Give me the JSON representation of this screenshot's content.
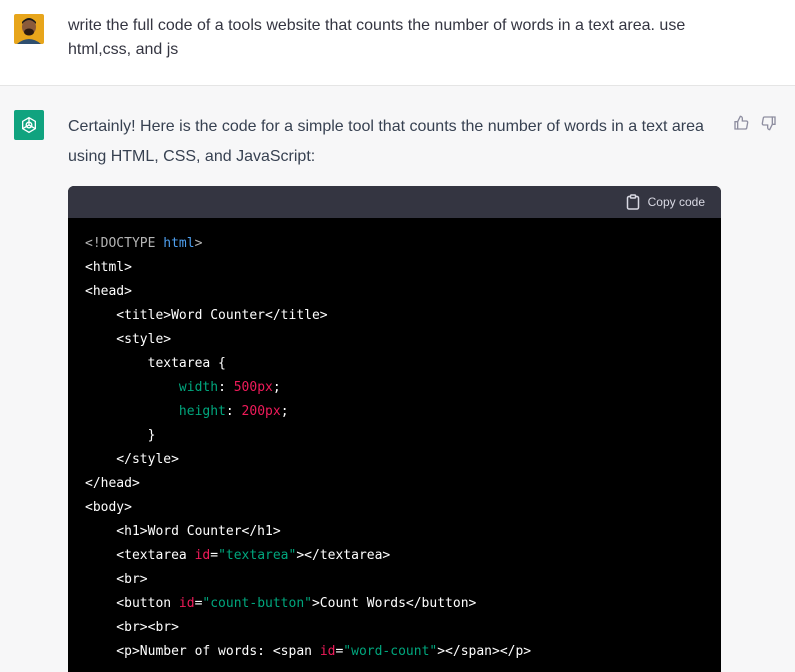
{
  "user_message": {
    "avatar": "user-avatar-photo",
    "text": "write the full code of a tools website that counts the number of words in a text area. use html,css, and js"
  },
  "assistant_message": {
    "avatar": "openai-logo-icon",
    "intro": "Certainly! Here is the code for a simple tool that counts the number of words in a text area using HTML, CSS, and JavaScript:",
    "code_block": {
      "copy_label": "Copy code",
      "lines": [
        [
          {
            "t": "<!DOCTYPE ",
            "c": "gray"
          },
          {
            "t": "html",
            "c": "blue"
          },
          {
            "t": ">",
            "c": "gray"
          }
        ],
        [
          {
            "t": "<html>",
            "c": "white"
          }
        ],
        [
          {
            "t": "<head>",
            "c": "white"
          }
        ],
        [
          {
            "t": "    <title>Word Counter</title>",
            "c": "white"
          }
        ],
        [
          {
            "t": "    <style>",
            "c": "white"
          }
        ],
        [
          {
            "t": "        textarea {",
            "c": "white"
          }
        ],
        [
          {
            "t": "            ",
            "c": "white"
          },
          {
            "t": "width",
            "c": "green"
          },
          {
            "t": ": ",
            "c": "white"
          },
          {
            "t": "500px",
            "c": "red"
          },
          {
            "t": ";",
            "c": "white"
          }
        ],
        [
          {
            "t": "            ",
            "c": "white"
          },
          {
            "t": "height",
            "c": "green"
          },
          {
            "t": ": ",
            "c": "white"
          },
          {
            "t": "200px",
            "c": "red"
          },
          {
            "t": ";",
            "c": "white"
          }
        ],
        [
          {
            "t": "        }",
            "c": "white"
          }
        ],
        [
          {
            "t": "    </style>",
            "c": "white"
          }
        ],
        [
          {
            "t": "</head>",
            "c": "white"
          }
        ],
        [
          {
            "t": "<body>",
            "c": "white"
          }
        ],
        [
          {
            "t": "    <h1>Word Counter</h1>",
            "c": "white"
          }
        ],
        [
          {
            "t": "    <textarea ",
            "c": "white"
          },
          {
            "t": "id",
            "c": "red"
          },
          {
            "t": "=",
            "c": "white"
          },
          {
            "t": "\"textarea\"",
            "c": "green"
          },
          {
            "t": "></textarea>",
            "c": "white"
          }
        ],
        [
          {
            "t": "    <br>",
            "c": "white"
          }
        ],
        [
          {
            "t": "    <button ",
            "c": "white"
          },
          {
            "t": "id",
            "c": "red"
          },
          {
            "t": "=",
            "c": "white"
          },
          {
            "t": "\"count-button\"",
            "c": "green"
          },
          {
            "t": ">Count Words</button>",
            "c": "white"
          }
        ],
        [
          {
            "t": "    <br><br>",
            "c": "white"
          }
        ],
        [
          {
            "t": "    <p>Number of words: <span ",
            "c": "white"
          },
          {
            "t": "id",
            "c": "red"
          },
          {
            "t": "=",
            "c": "white"
          },
          {
            "t": "\"word-count\"",
            "c": "green"
          },
          {
            "t": "></span></p>",
            "c": "white"
          }
        ]
      ]
    }
  },
  "feedback": {
    "thumbs_up": "thumbs-up-icon",
    "thumbs_down": "thumbs-down-icon"
  },
  "colors": {
    "accent": "#10a37f",
    "assistant_bg": "#f7f7f8",
    "code_bg": "#000000",
    "code_header_bg": "#343541"
  }
}
